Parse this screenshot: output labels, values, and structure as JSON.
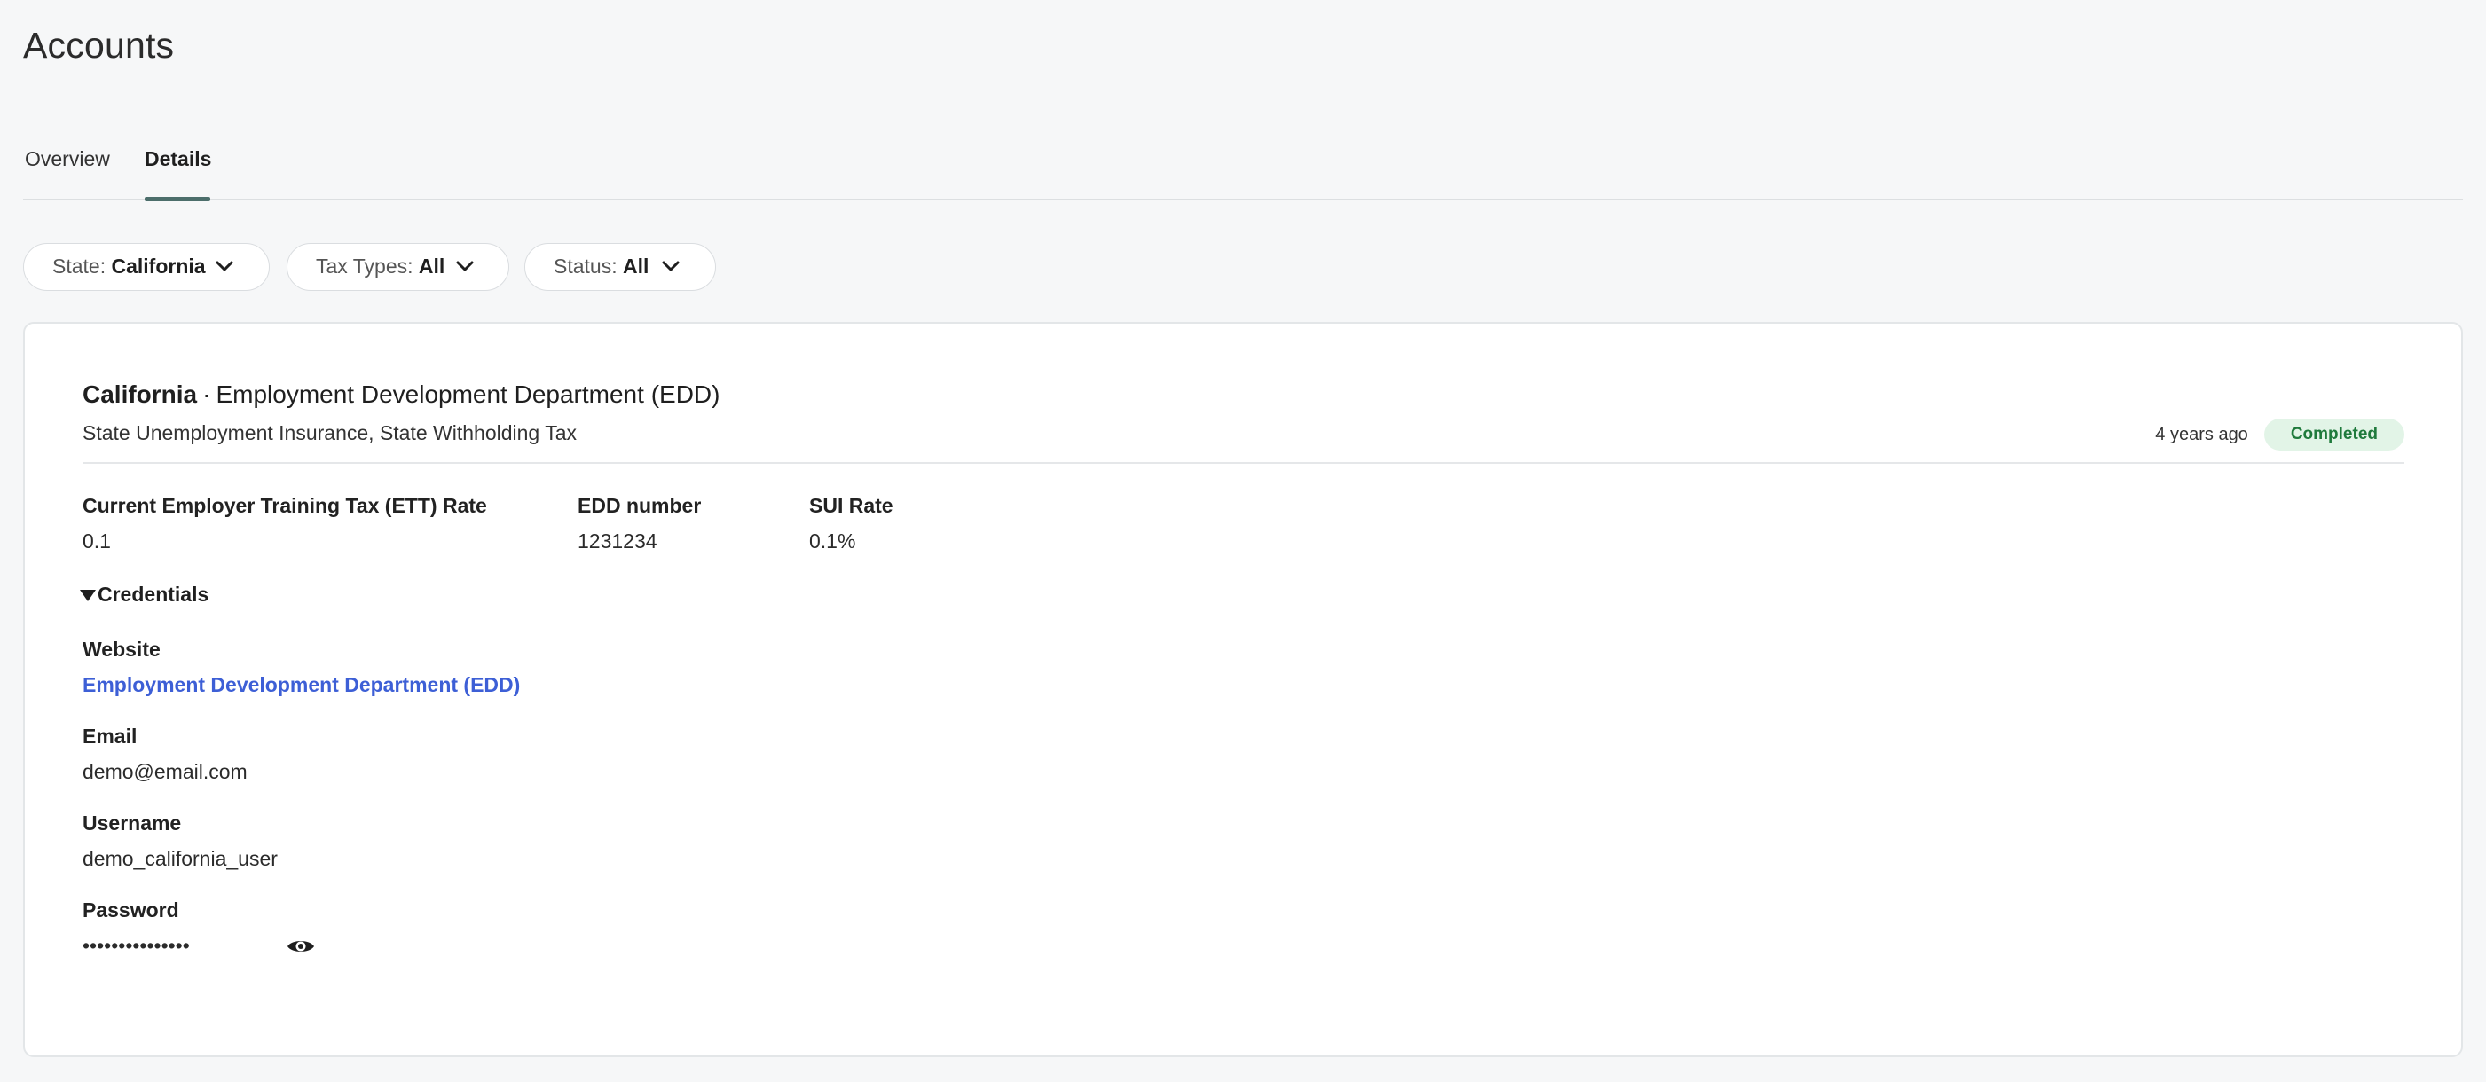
{
  "header": {
    "title": "Accounts"
  },
  "tabs": [
    {
      "label": "Overview",
      "active": false
    },
    {
      "label": "Details",
      "active": true
    }
  ],
  "filters": {
    "state": {
      "label": "State: ",
      "value": "California"
    },
    "tax_types": {
      "label": "Tax Types: ",
      "value": "All"
    },
    "status": {
      "label": "Status: ",
      "value": "All"
    }
  },
  "account": {
    "state": "California",
    "separator": "·",
    "agency": "Employment Development Department (EDD)",
    "tax_types": "State Unemployment Insurance, State Withholding Tax",
    "updated": "4 years ago",
    "status": "Completed",
    "fields": [
      {
        "label": "Current Employer Training Tax (ETT) Rate",
        "value": "0.1"
      },
      {
        "label": "EDD number",
        "value": "1231234"
      },
      {
        "label": "SUI Rate",
        "value": "0.1%"
      }
    ],
    "credentials": {
      "toggle_label": "Credentials",
      "expanded": true,
      "website": {
        "label": "Website",
        "value": "Employment Development Department (EDD)"
      },
      "email": {
        "label": "Email",
        "value": "demo@email.com"
      },
      "username": {
        "label": "Username",
        "value": "demo_california_user"
      },
      "password": {
        "label": "Password",
        "value": "•••••••••••••••"
      }
    }
  },
  "icons": {
    "filter_chevron": "chevron-down-icon",
    "credentials_toggle": "caret-down-icon",
    "reveal_password": "eye-icon"
  },
  "colors": {
    "background": "#f6f7f8",
    "tab_underline": "#4c6e6b",
    "link": "#3d5fd6",
    "badge_bg": "#e2f4e7",
    "badge_text": "#1f7a3c"
  }
}
